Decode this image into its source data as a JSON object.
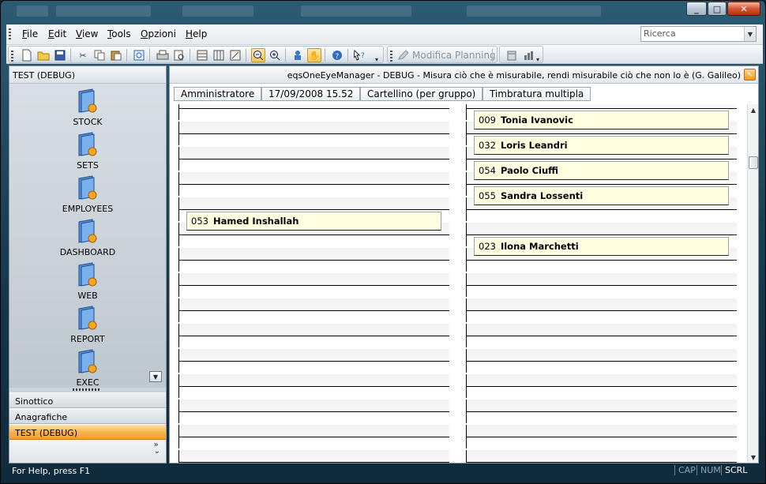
{
  "window": {
    "controls": {
      "minimize": "_",
      "maximize": "□",
      "close": "✕"
    }
  },
  "menubar": {
    "items": [
      {
        "label": "File",
        "accel": "F",
        "rest": "ile"
      },
      {
        "label": "Edit",
        "accel": "E",
        "rest": "dit"
      },
      {
        "label": "View",
        "accel": "V",
        "rest": "iew"
      },
      {
        "label": "Tools",
        "accel": "T",
        "rest": "ools"
      },
      {
        "label": "Opzioni",
        "accel": "O",
        "rest": "pzioni"
      },
      {
        "label": "Help",
        "accel": "H",
        "rest": "elp"
      }
    ],
    "search": {
      "placeholder": "Ricerca"
    }
  },
  "toolbar": {
    "icons": [
      "new-icon",
      "open-icon",
      "save-icon",
      "cut-icon",
      "copy-icon",
      "paste-icon",
      "preview-icon",
      "print-icon",
      "print-preview-icon",
      "grid-icon",
      "grid-edit-icon",
      "grid-tools-icon",
      "zoom-out-icon",
      "zoom-in-icon",
      "users-icon",
      "hand-icon",
      "help-icon",
      "whats-this-icon"
    ],
    "modifica_label": "Modifica Planning",
    "right_icons": [
      "calendar-icon",
      "chart-icon"
    ]
  },
  "leftpane": {
    "title": "TEST (DEBUG)",
    "shortcuts": [
      "STOCK",
      "SETS",
      "EMPLOYEES",
      "DASHBOARD",
      "WEB",
      "REPORT",
      "EXEC"
    ],
    "nav": [
      {
        "label": "Sinottico",
        "active": false
      },
      {
        "label": "Anagrafiche",
        "active": false
      },
      {
        "label": "TEST (DEBUG)",
        "active": true
      }
    ],
    "more": "»"
  },
  "main": {
    "title": "eqsOneEyeManager - DEBUG - Misura ciò che è misurabile, rendi misurabile ciò che non lo è (G. Galileo)",
    "info": {
      "user": "Amministratore",
      "datetime": "17/09/2008 15.52",
      "view": "Cartellino (per gruppo)",
      "mode": "Timbratura multipla"
    },
    "left_column": [
      {
        "row": 4,
        "code": "053",
        "name": "Hamed Inshallah"
      }
    ],
    "right_column": [
      {
        "row": 0,
        "code": "009",
        "name": "Tonia Ivanovic"
      },
      {
        "row": 1,
        "code": "032",
        "name": "Loris Leandri"
      },
      {
        "row": 2,
        "code": "054",
        "name": "Paolo Ciuffi"
      },
      {
        "row": 3,
        "code": "055",
        "name": "Sandra Lossenti"
      },
      {
        "row": 5,
        "code": "023",
        "name": "Ilona Marchetti"
      }
    ]
  },
  "statusbar": {
    "text": "For Help, press F1",
    "indicators": [
      {
        "label": "CAP",
        "on": false
      },
      {
        "label": "NUM",
        "on": false
      },
      {
        "label": "SCRL",
        "on": true
      }
    ]
  }
}
